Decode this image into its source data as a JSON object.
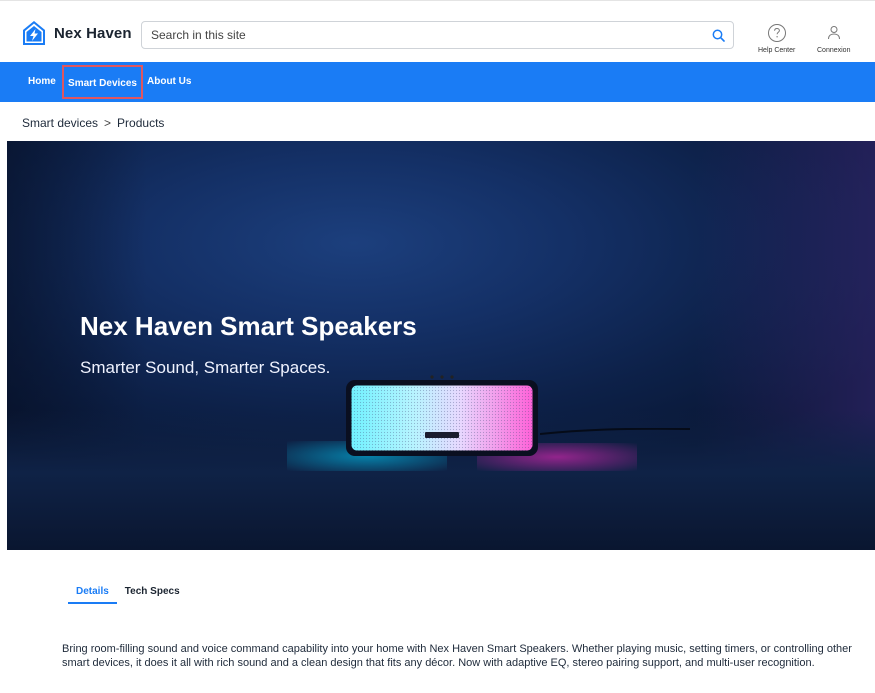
{
  "brand": {
    "name": "Nex Haven",
    "logo_icon": "house-lightning-icon",
    "accent": "#1a7cf5"
  },
  "search": {
    "placeholder": "Search in this site",
    "icon": "search-icon"
  },
  "header_tools": {
    "help_label": "Help Center",
    "account_label": "Connexion"
  },
  "nav": {
    "items": [
      {
        "label": "Home"
      },
      {
        "label": "Smart Devices",
        "highlighted": true
      },
      {
        "label": "About Us"
      }
    ],
    "background": "#1a7cf5"
  },
  "breadcrumb": {
    "items": [
      "Smart devices",
      "Products"
    ],
    "separator": ">"
  },
  "hero": {
    "title": "Nex Haven Smart Speakers",
    "subtitle": "Smarter Sound, Smarter Spaces."
  },
  "tabs": {
    "items": [
      {
        "label": "Details",
        "active": true
      },
      {
        "label": "Tech Specs",
        "active": false
      }
    ]
  },
  "description": "Bring room-filling sound and voice command capability into your home with Nex Haven Smart Speakers. Whether playing music, setting timers, or controlling other smart devices, it does it all with rich sound and a clean design that fits any décor. Now with adaptive EQ, stereo pairing support, and multi-user recognition."
}
